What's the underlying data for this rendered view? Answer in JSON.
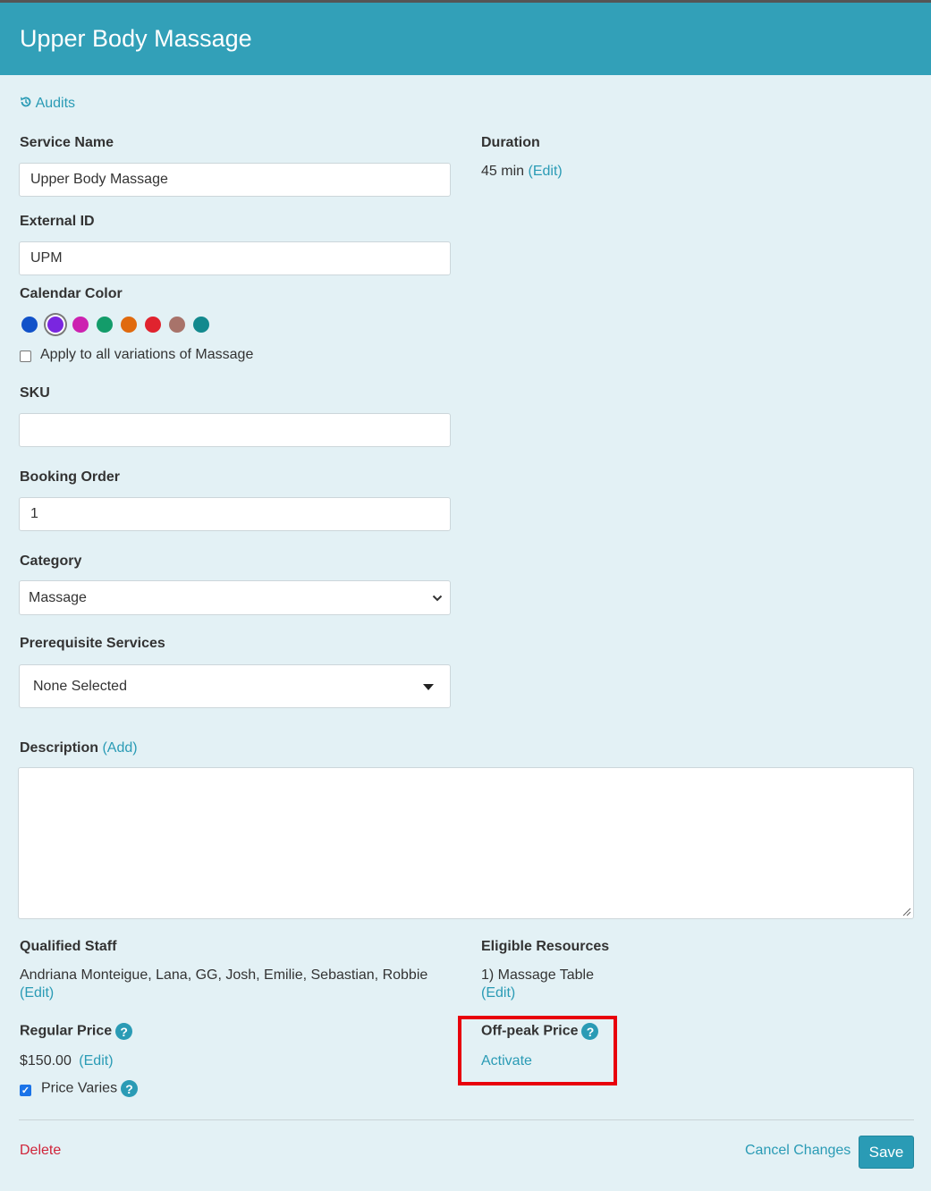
{
  "header": {
    "title": "Upper Body Massage"
  },
  "audits": {
    "label": "Audits",
    "icon": "history-icon"
  },
  "service_name": {
    "label": "Service Name",
    "value": "Upper Body Massage"
  },
  "duration": {
    "label": "Duration",
    "value": "45 min",
    "edit": "(Edit)"
  },
  "external_id": {
    "label": "External ID",
    "value": "UPM"
  },
  "calendar_color": {
    "label": "Calendar Color",
    "colors": [
      "#1152c9",
      "#7a26e0",
      "#cc22b0",
      "#139c6a",
      "#e06a0e",
      "#e0232e",
      "#a8736a",
      "#13898e"
    ],
    "selected_index": 1,
    "apply_all_label": "Apply to all variations of Massage",
    "apply_all_checked": false
  },
  "sku": {
    "label": "SKU",
    "value": ""
  },
  "booking_order": {
    "label": "Booking Order",
    "value": "1"
  },
  "category": {
    "label": "Category",
    "value": "Massage"
  },
  "prerequisite": {
    "label": "Prerequisite Services",
    "value": "None Selected"
  },
  "description": {
    "label": "Description",
    "add": "(Add)",
    "value": ""
  },
  "qualified_staff": {
    "label": "Qualified Staff",
    "value": "Andriana Monteigue, Lana, GG, Josh, Emilie, Sebastian, Robbie",
    "edit": "(Edit)"
  },
  "eligible_resources": {
    "label": "Eligible Resources",
    "value": "1) Massage Table",
    "edit": "(Edit)"
  },
  "regular_price": {
    "label": "Regular Price",
    "value": "$150.00",
    "edit": "(Edit)",
    "price_varies_label": "Price Varies",
    "price_varies_checked": true
  },
  "offpeak_price": {
    "label": "Off-peak Price",
    "activate": "Activate",
    "highlight_color": "#e8000b"
  },
  "help_glyph": "?",
  "check_glyph": "✓",
  "footer": {
    "delete": "Delete",
    "cancel": "Cancel Changes",
    "save": "Save"
  },
  "colors": {
    "header": "#32a0b8",
    "background": "#e3f1f5",
    "link": "#2a9bb5",
    "delete": "#d0253a"
  }
}
